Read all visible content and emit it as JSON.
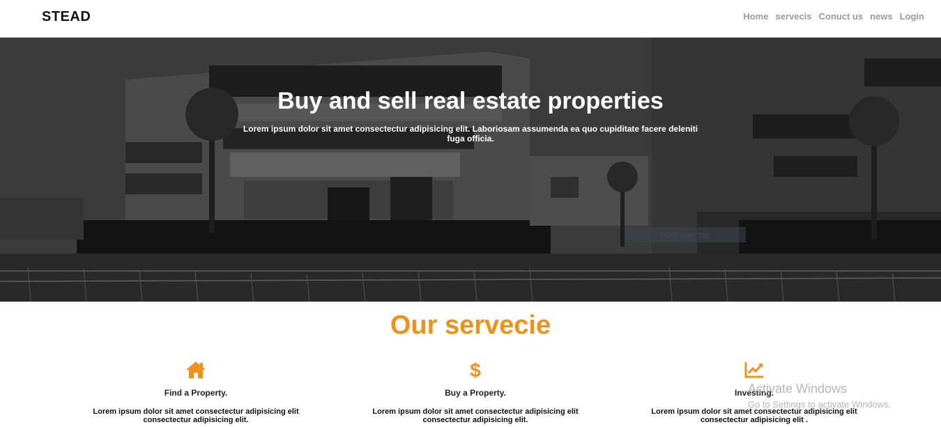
{
  "nav": {
    "brand": "STEAD",
    "links": [
      "Home",
      "servecis",
      "Conuct us",
      "news",
      "Login"
    ]
  },
  "hero": {
    "title": "Buy and sell real estate properties",
    "subtitle": "Lorem ipsum dolor sit amet consectectur adipisicing elit. Laboriosam assumenda ea quo cupiditate facere deleniti fuga officia.",
    "button_label": "Fullscreen stip"
  },
  "services": {
    "title": "Our servecie",
    "accent": "#f39019",
    "items": [
      {
        "icon": "home-icon",
        "name": "Find a Property.",
        "desc": "Lorem ipsum dolor sit amet consectectur adipisicing elit consectectur adipisicing elit."
      },
      {
        "icon": "dollar-icon",
        "name": "Buy a Property.",
        "desc": "Lorem ipsum dolor sit amet consectectur adipisicing elit consectectur adipisicing elit."
      },
      {
        "icon": "chart-line-icon",
        "name": "Investing.",
        "desc": "Lorem ipsum dolor sit amet consectectur adipisicing elit consectectur adipisicing elit ."
      }
    ]
  },
  "watermark": {
    "line1": "Activate Windows",
    "line2": "Go to Settings to activate Windows."
  }
}
